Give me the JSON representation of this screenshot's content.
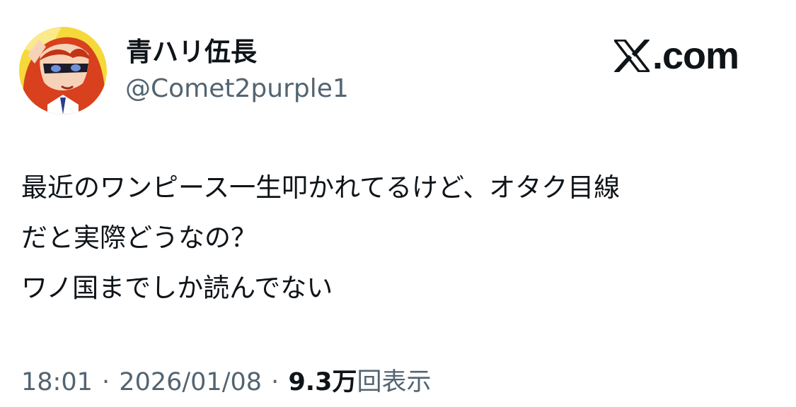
{
  "author": {
    "display_name": "青ハリ伍長",
    "handle": "@Comet2purple1",
    "avatar_icon": "anime-avatar-icon"
  },
  "brand": {
    "logo_icon": "x-logo-icon",
    "suffix": ".com"
  },
  "tweet": {
    "lines": [
      "最近のワンピース一生叩かれてるけど、オタク目線",
      "だと実際どうなの？",
      "ワノ国までしか読んでない"
    ]
  },
  "meta": {
    "time": "18:01",
    "separator": "·",
    "date": "2026/01/08",
    "views_count": "9.3万",
    "views_label": "回表示"
  },
  "colors": {
    "text_primary": "#0f1419",
    "text_secondary": "#536471",
    "avatar_hair": "#d8401e",
    "avatar_background": "#f5d93a"
  }
}
